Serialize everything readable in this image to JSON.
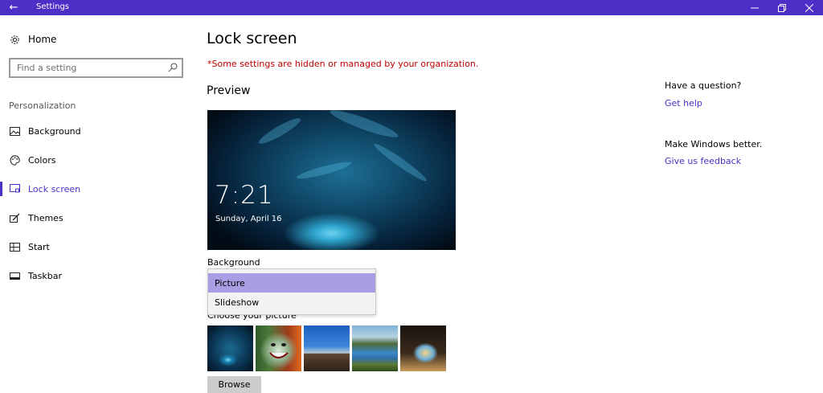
{
  "window": {
    "title": "Settings",
    "accent_color": "#4c2fc7"
  },
  "sidebar": {
    "home_label": "Home",
    "search_placeholder": "Find a setting",
    "section_label": "Personalization",
    "items": [
      {
        "label": "Background",
        "icon": "picture-icon",
        "active": false
      },
      {
        "label": "Colors",
        "icon": "palette-icon",
        "active": false
      },
      {
        "label": "Lock screen",
        "icon": "lock-screen-icon",
        "active": true
      },
      {
        "label": "Themes",
        "icon": "brush-icon",
        "active": false
      },
      {
        "label": "Start",
        "icon": "start-grid-icon",
        "active": false
      },
      {
        "label": "Taskbar",
        "icon": "taskbar-icon",
        "active": false
      }
    ]
  },
  "main": {
    "title": "Lock screen",
    "org_notice": "*Some settings are hidden or managed by your organization.",
    "preview_heading": "Preview",
    "preview": {
      "time": "7:21",
      "date": "Sunday, April 16"
    },
    "background_label": "Background",
    "background_dropdown": {
      "options": [
        "Picture",
        "Slideshow"
      ],
      "selected": "Picture"
    },
    "choose_picture_label": "Choose your picture",
    "thumbnails": [
      {
        "name": "ice-cave"
      },
      {
        "name": "joker"
      },
      {
        "name": "dune-landscape"
      },
      {
        "name": "lake-valley"
      },
      {
        "name": "rock-arch-beach"
      }
    ],
    "browse_label": "Browse"
  },
  "right": {
    "question": "Have a question?",
    "help_link": "Get help",
    "improve": "Make Windows better.",
    "feedback_link": "Give us feedback"
  }
}
